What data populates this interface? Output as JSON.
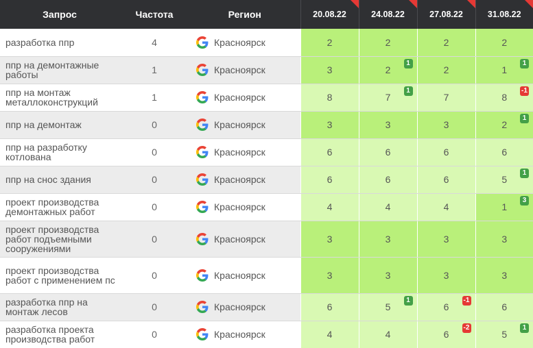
{
  "headers": {
    "query": "Запрос",
    "frequency": "Частота",
    "region": "Регион",
    "dates": [
      "20.08.22",
      "24.08.22",
      "27.08.22",
      "31.08.22"
    ]
  },
  "colors": {
    "header_bg": "#2f3033",
    "green_strong": "#b9f07a",
    "green_light": "#d9f9b3",
    "badge_up": "#43a047",
    "badge_down": "#e53935"
  },
  "engine_icon": "google-icon",
  "rows": [
    {
      "query": "разработка ппр",
      "freq": "4",
      "region": "Красноярск",
      "tall": false,
      "cells": [
        {
          "v": "2",
          "s": "g1",
          "b": ""
        },
        {
          "v": "2",
          "s": "g1",
          "b": ""
        },
        {
          "v": "2",
          "s": "g1",
          "b": ""
        },
        {
          "v": "2",
          "s": "g1",
          "b": ""
        }
      ]
    },
    {
      "query": "ппр на демонтажные работы",
      "freq": "1",
      "region": "Красноярск",
      "tall": false,
      "cells": [
        {
          "v": "3",
          "s": "g1",
          "b": ""
        },
        {
          "v": "2",
          "s": "g1",
          "b": "1"
        },
        {
          "v": "2",
          "s": "g1",
          "b": ""
        },
        {
          "v": "1",
          "s": "g1",
          "b": "1"
        }
      ]
    },
    {
      "query": "ппр на монтаж металлоконструкций",
      "freq": "1",
      "region": "Красноярск",
      "tall": false,
      "cells": [
        {
          "v": "8",
          "s": "g2",
          "b": ""
        },
        {
          "v": "7",
          "s": "g2",
          "b": "1"
        },
        {
          "v": "7",
          "s": "g2",
          "b": ""
        },
        {
          "v": "8",
          "s": "g2",
          "b": "-1"
        }
      ]
    },
    {
      "query": "ппр на демонтаж",
      "freq": "0",
      "region": "Красноярск",
      "tall": false,
      "cells": [
        {
          "v": "3",
          "s": "g1",
          "b": ""
        },
        {
          "v": "3",
          "s": "g1",
          "b": ""
        },
        {
          "v": "3",
          "s": "g1",
          "b": ""
        },
        {
          "v": "2",
          "s": "g1",
          "b": "1"
        }
      ]
    },
    {
      "query": "ппр на разработку котлована",
      "freq": "0",
      "region": "Красноярск",
      "tall": false,
      "cells": [
        {
          "v": "6",
          "s": "g2",
          "b": ""
        },
        {
          "v": "6",
          "s": "g2",
          "b": ""
        },
        {
          "v": "6",
          "s": "g2",
          "b": ""
        },
        {
          "v": "6",
          "s": "g2",
          "b": ""
        }
      ]
    },
    {
      "query": "ппр на снос здания",
      "freq": "0",
      "region": "Красноярск",
      "tall": false,
      "cells": [
        {
          "v": "6",
          "s": "g2",
          "b": ""
        },
        {
          "v": "6",
          "s": "g2",
          "b": ""
        },
        {
          "v": "6",
          "s": "g2",
          "b": ""
        },
        {
          "v": "5",
          "s": "g2",
          "b": "1"
        }
      ]
    },
    {
      "query": "проект производства демонтажных работ",
      "freq": "0",
      "region": "Красноярск",
      "tall": false,
      "cells": [
        {
          "v": "4",
          "s": "g2",
          "b": ""
        },
        {
          "v": "4",
          "s": "g2",
          "b": ""
        },
        {
          "v": "4",
          "s": "g2",
          "b": ""
        },
        {
          "v": "1",
          "s": "g1",
          "b": "3"
        }
      ]
    },
    {
      "query": "проект производства работ подъемными сооружениями",
      "freq": "0",
      "region": "Красноярск",
      "tall": true,
      "cells": [
        {
          "v": "3",
          "s": "g1",
          "b": ""
        },
        {
          "v": "3",
          "s": "g1",
          "b": ""
        },
        {
          "v": "3",
          "s": "g1",
          "b": ""
        },
        {
          "v": "3",
          "s": "g1",
          "b": ""
        }
      ]
    },
    {
      "query": "проект производства работ с применением пс",
      "freq": "0",
      "region": "Красноярск",
      "tall": true,
      "cells": [
        {
          "v": "3",
          "s": "g1",
          "b": ""
        },
        {
          "v": "3",
          "s": "g1",
          "b": ""
        },
        {
          "v": "3",
          "s": "g1",
          "b": ""
        },
        {
          "v": "3",
          "s": "g1",
          "b": ""
        }
      ]
    },
    {
      "query": "разработка ппр на монтаж лесов",
      "freq": "0",
      "region": "Красноярск",
      "tall": false,
      "cells": [
        {
          "v": "6",
          "s": "g2",
          "b": ""
        },
        {
          "v": "5",
          "s": "g2",
          "b": "1"
        },
        {
          "v": "6",
          "s": "g2",
          "b": "-1"
        },
        {
          "v": "6",
          "s": "g2",
          "b": ""
        }
      ]
    },
    {
      "query": "разработка проекта производства работ",
      "freq": "0",
      "region": "Красноярск",
      "tall": false,
      "cells": [
        {
          "v": "4",
          "s": "g2",
          "b": ""
        },
        {
          "v": "4",
          "s": "g2",
          "b": ""
        },
        {
          "v": "6",
          "s": "g2",
          "b": "-2"
        },
        {
          "v": "5",
          "s": "g2",
          "b": "1"
        }
      ]
    }
  ]
}
